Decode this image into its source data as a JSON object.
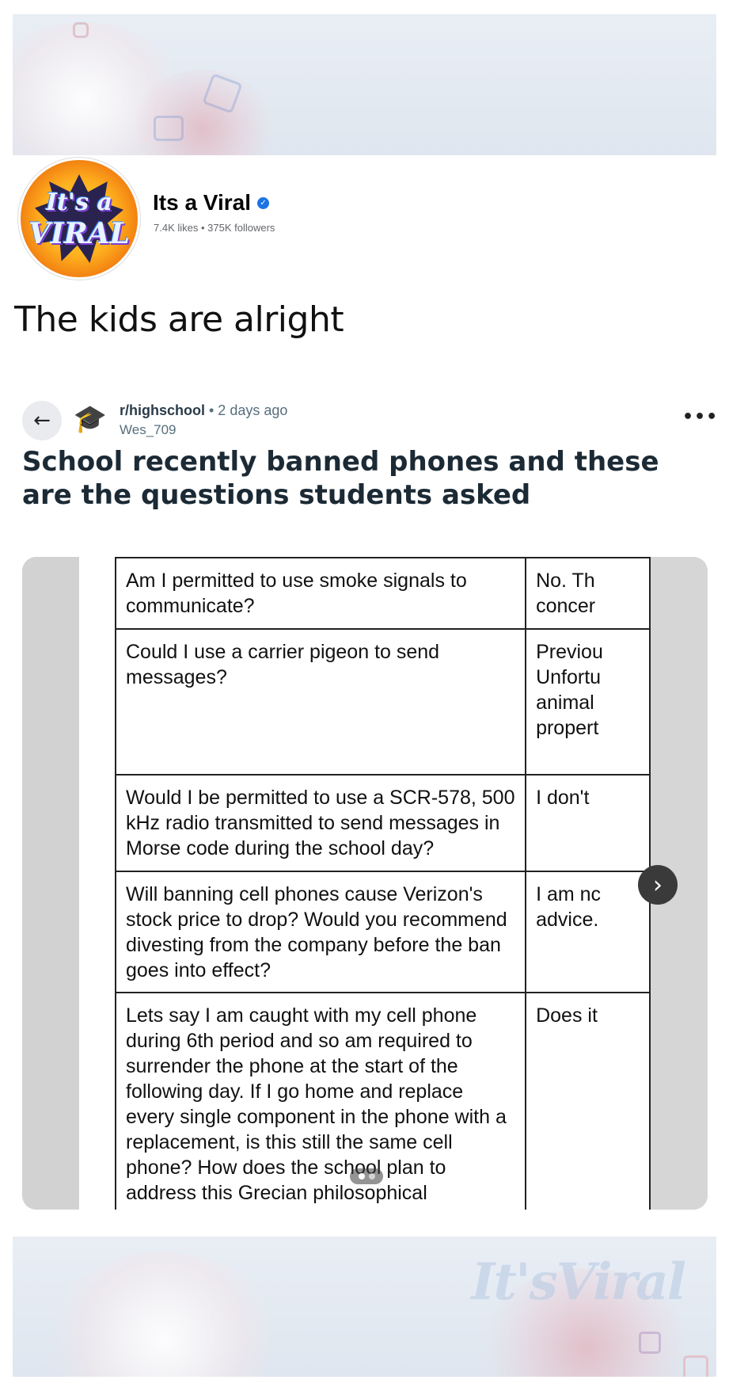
{
  "page": {
    "name": "Its a Viral",
    "stats": "7.4K likes • 375K followers",
    "avatar_logo": [
      "It's a",
      "VIRAL"
    ],
    "cover_watermark": "It'sViral"
  },
  "post": {
    "caption": "The kids are alright"
  },
  "reddit": {
    "subreddit": "r/highschool",
    "meta": " • 2 days ago",
    "username": "Wes_709",
    "more_label": "•••",
    "title": "School recently banned phones and these are the questions students asked",
    "rows": [
      {
        "question": "Am I permitted to use smoke signals to communicate?",
        "answer_lines": [
          "No. Th",
          "concer"
        ]
      },
      {
        "question": "Could I use a carrier pigeon to send messages?",
        "answer_lines": [
          "Previou",
          "Unfortu",
          "animal",
          "propert"
        ]
      },
      {
        "question": "Would I be permitted to use a SCR-578, 500 kHz radio transmitted to send messages in Morse code during the school day?",
        "answer_lines": [
          "I don't"
        ]
      },
      {
        "question": "Will banning cell phones cause Verizon's stock price to drop? Would you recommend divesting from the company before the ban goes into effect?",
        "answer_lines": [
          "I am nc",
          "advice."
        ]
      },
      {
        "question": "Lets say I am caught with my cell phone during 6th period and so am required to surrender the phone at the start of the following day. If I go home and replace every single component in the phone with a replacement, is this still the same cell phone? How does the school plan to address this Grecian philosophical dilemma?",
        "answer_lines": [
          "Does it"
        ]
      }
    ]
  },
  "icons": {
    "back": "arrow-left-icon",
    "next": "chevron-right-icon",
    "verified": "verified-badge-icon"
  },
  "colors": {
    "verified_blue": "#1b74e4",
    "meta_gray": "#65676b"
  }
}
